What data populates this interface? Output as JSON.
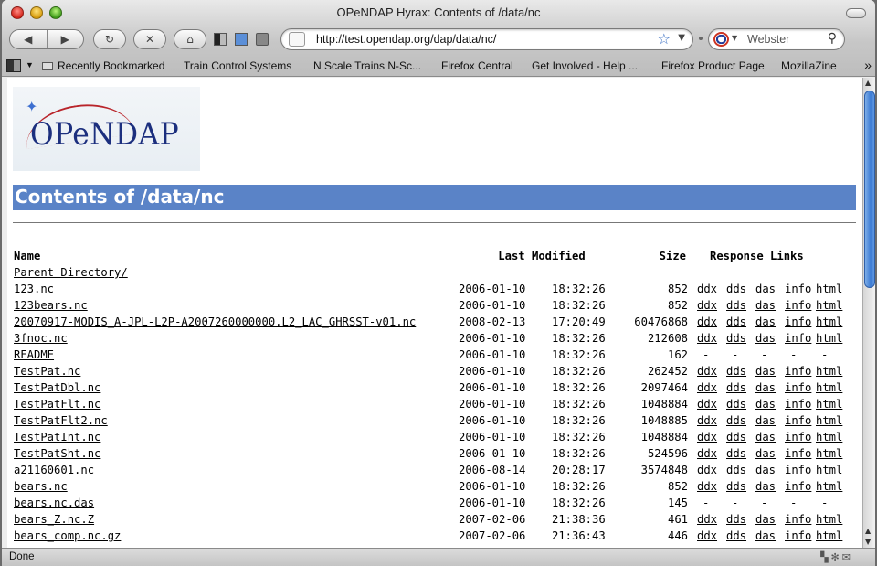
{
  "window": {
    "title": "OPeNDAP Hyrax: Contents of /data/nc"
  },
  "toolbar": {
    "back": "◀",
    "forward": "▶",
    "reload": "↻",
    "stop": "✕",
    "home": "⌂",
    "url": "http://test.opendap.org/dap/data/nc/",
    "search_engine": "Webster",
    "star": "☆",
    "dropdown": "▼",
    "search_icon": "⚲"
  },
  "bookmarks": {
    "items": [
      "Recently Bookmarked",
      "Train Control Systems",
      "N Scale Trains N-Sc...",
      "Firefox Central",
      "Get Involved - Help ...",
      "Firefox Product Page",
      "MozillaZine"
    ],
    "more": "»"
  },
  "page": {
    "logo_text": "OPeNDAP",
    "heading": "Contents of /data/nc",
    "columns": {
      "name": "Name",
      "modified": "Last Modified",
      "size": "Size",
      "links": "Response Links"
    },
    "parent": "Parent Directory/",
    "rows": [
      {
        "name": "123.nc",
        "date": "2006-01-10",
        "time": "18:32:26",
        "size": "852",
        "links": [
          "ddx",
          "dds",
          "das",
          "info",
          "html"
        ]
      },
      {
        "name": "123bears.nc",
        "date": "2006-01-10",
        "time": "18:32:26",
        "size": "852",
        "links": [
          "ddx",
          "dds",
          "das",
          "info",
          "html"
        ]
      },
      {
        "name": "20070917-MODIS_A-JPL-L2P-A2007260000000.L2_LAC_GHRSST-v01.nc",
        "date": "2008-02-13",
        "time": "17:20:49",
        "size": "60476868",
        "links": [
          "ddx",
          "dds",
          "das",
          "info",
          "html"
        ]
      },
      {
        "name": "3fnoc.nc",
        "date": "2006-01-10",
        "time": "18:32:26",
        "size": "212608",
        "links": [
          "ddx",
          "dds",
          "das",
          "info",
          "html"
        ]
      },
      {
        "name": "README",
        "date": "2006-01-10",
        "time": "18:32:26",
        "size": "162",
        "links": [
          "-",
          "-",
          "-",
          "-",
          "-"
        ]
      },
      {
        "name": "TestPat.nc",
        "date": "2006-01-10",
        "time": "18:32:26",
        "size": "262452",
        "links": [
          "ddx",
          "dds",
          "das",
          "info",
          "html"
        ]
      },
      {
        "name": "TestPatDbl.nc",
        "date": "2006-01-10",
        "time": "18:32:26",
        "size": "2097464",
        "links": [
          "ddx",
          "dds",
          "das",
          "info",
          "html"
        ]
      },
      {
        "name": "TestPatFlt.nc",
        "date": "2006-01-10",
        "time": "18:32:26",
        "size": "1048884",
        "links": [
          "ddx",
          "dds",
          "das",
          "info",
          "html"
        ]
      },
      {
        "name": "TestPatFlt2.nc",
        "date": "2006-01-10",
        "time": "18:32:26",
        "size": "1048885",
        "links": [
          "ddx",
          "dds",
          "das",
          "info",
          "html"
        ]
      },
      {
        "name": "TestPatInt.nc",
        "date": "2006-01-10",
        "time": "18:32:26",
        "size": "1048884",
        "links": [
          "ddx",
          "dds",
          "das",
          "info",
          "html"
        ]
      },
      {
        "name": "TestPatSht.nc",
        "date": "2006-01-10",
        "time": "18:32:26",
        "size": "524596",
        "links": [
          "ddx",
          "dds",
          "das",
          "info",
          "html"
        ]
      },
      {
        "name": "a21160601.nc",
        "date": "2006-08-14",
        "time": "20:28:17",
        "size": "3574848",
        "links": [
          "ddx",
          "dds",
          "das",
          "info",
          "html"
        ]
      },
      {
        "name": "bears.nc",
        "date": "2006-01-10",
        "time": "18:32:26",
        "size": "852",
        "links": [
          "ddx",
          "dds",
          "das",
          "info",
          "html"
        ]
      },
      {
        "name": "bears.nc.das",
        "date": "2006-01-10",
        "time": "18:32:26",
        "size": "145",
        "links": [
          "-",
          "-",
          "-",
          "-",
          "-"
        ]
      },
      {
        "name": "bears_Z.nc.Z",
        "date": "2007-02-06",
        "time": "21:38:36",
        "size": "461",
        "links": [
          "ddx",
          "dds",
          "das",
          "info",
          "html"
        ]
      },
      {
        "name": "bears_comp.nc.gz",
        "date": "2007-02-06",
        "time": "21:36:43",
        "size": "446",
        "links": [
          "ddx",
          "dds",
          "das",
          "info",
          "html"
        ]
      }
    ]
  },
  "status": {
    "text": "Done"
  },
  "colors": {
    "heading_bg": "#5a83c7",
    "logo_text": "#1c2f7e"
  }
}
